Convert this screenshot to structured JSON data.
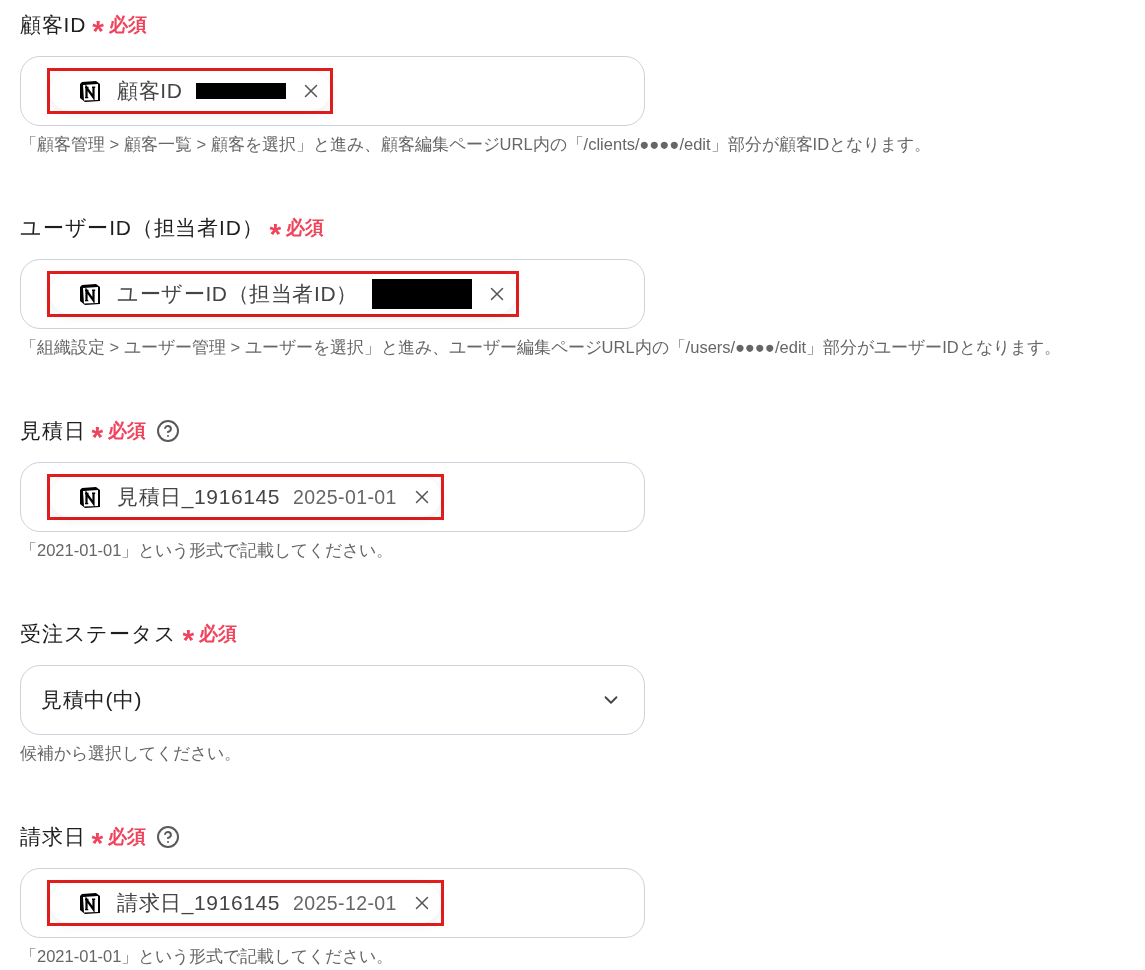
{
  "fields": [
    {
      "label": "顧客ID",
      "required_mark": "*",
      "required_text": "必須",
      "help": false,
      "kind": "chip",
      "chip": {
        "label": "顧客ID",
        "redacted": true,
        "highlighted": true
      },
      "hint": "「顧客管理 > 顧客一覧 > 顧客を選択」と進み、顧客編集ページURL内の「/clients/●●●●/edit」部分が顧客IDとなります。"
    },
    {
      "label": "ユーザーID（担当者ID）",
      "required_mark": "*",
      "required_text": "必須",
      "help": false,
      "kind": "chip",
      "chip": {
        "label": "ユーザーID（担当者ID）",
        "redacted": true,
        "highlighted": true
      },
      "hint": "「組織設定 > ユーザー管理 > ユーザーを選択」と進み、ユーザー編集ページURL内の「/users/●●●●/edit」部分がユーザーIDとなります。"
    },
    {
      "label": "見積日",
      "required_mark": "*",
      "required_text": "必須",
      "help": true,
      "kind": "chip",
      "chip": {
        "label": "見積日_1916145",
        "value": "2025-01-01",
        "redacted": false,
        "highlighted": true
      },
      "hint": "「2021-01-01」という形式で記載してください。"
    },
    {
      "label": "受注ステータス",
      "required_mark": "*",
      "required_text": "必須",
      "help": false,
      "kind": "select",
      "value": "見積中(中)",
      "hint": "候補から選択してください。"
    },
    {
      "label": "請求日",
      "required_mark": "*",
      "required_text": "必須",
      "help": true,
      "kind": "chip",
      "chip": {
        "label": "請求日_1916145",
        "value": "2025-12-01",
        "redacted": false,
        "highlighted": true
      },
      "hint": "「2021-01-01」という形式で記載してください。"
    }
  ]
}
